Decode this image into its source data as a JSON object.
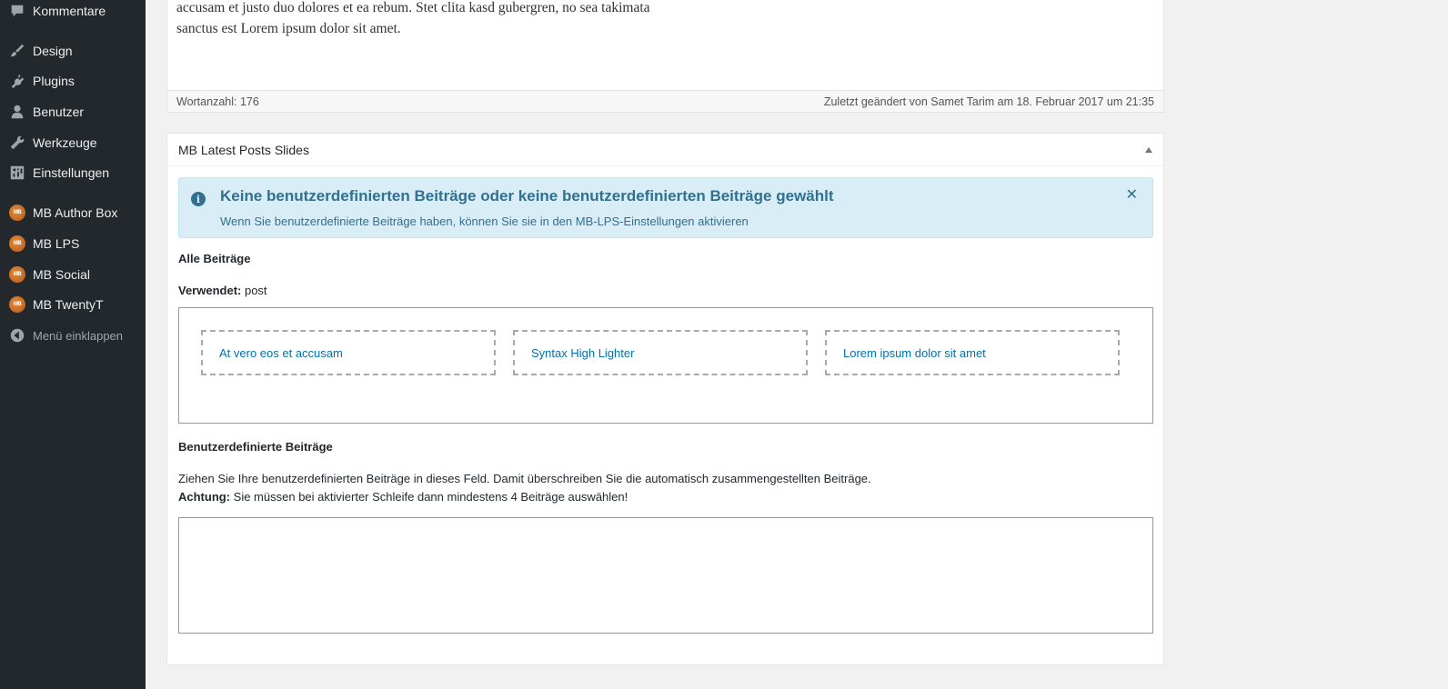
{
  "sidebar": {
    "items": [
      {
        "label": "Kommentare",
        "icon": "comment-icon"
      },
      {
        "label": "Design",
        "icon": "brush-icon"
      },
      {
        "label": "Plugins",
        "icon": "plugin-icon"
      },
      {
        "label": "Benutzer",
        "icon": "user-icon"
      },
      {
        "label": "Werkzeuge",
        "icon": "wrench-icon"
      },
      {
        "label": "Einstellungen",
        "icon": "settings-icon"
      },
      {
        "label": "MB Author Box",
        "icon": "mb-logo-icon"
      },
      {
        "label": "MB LPS",
        "icon": "mb-logo-icon"
      },
      {
        "label": "MB Social",
        "icon": "mb-logo-icon"
      },
      {
        "label": "MB TwentyT",
        "icon": "mb-logo-icon"
      }
    ],
    "collapse_label": "Menü einklappen",
    "mb_logo_text": "MB"
  },
  "editor": {
    "text_line1": "accusam et justo duo dolores et ea rebum. Stet clita kasd gubergren, no sea takimata",
    "text_line2": "sanctus est Lorem ipsum dolor sit amet.",
    "word_count": "Wortanzahl: 176",
    "last_modified": "Zuletzt geändert von Samet Tarim am 18. Februar 2017 um 21:35"
  },
  "metabox": {
    "title": "MB Latest Posts Slides",
    "notice": {
      "title": "Keine benutzerdefinierten Beiträge oder keine benutzerdefinierten Beiträge gewählt",
      "text": "Wenn Sie benutzerdefinierte Beiträge haben, können Sie sie in den MB-LPS-Einstellungen aktivieren",
      "close": "✕",
      "info_glyph": "i"
    },
    "all_posts_label": "Alle Beiträge",
    "used_label": "Verwendet:",
    "used_value": " post",
    "posts": [
      "At vero eos et accusam",
      "Syntax High Lighter",
      "Lorem ipsum dolor sit amet"
    ],
    "custom_label": "Benutzerdefinierte Beiträge",
    "custom_desc": "Ziehen Sie Ihre benutzerdefinierten Beiträge in dieses Feld. Damit überschreiben Sie die automatisch zusammengestellten Beiträge.",
    "warning_label": "Achtung:",
    "warning_text": " Sie müssen bei aktivierter Schleife dann mindestens 4 Beiträge auswählen!"
  },
  "colors": {
    "sidebar_bg": "#23282d",
    "notice_bg": "#d9edf7",
    "notice_text": "#31708f",
    "link": "#0073aa"
  }
}
